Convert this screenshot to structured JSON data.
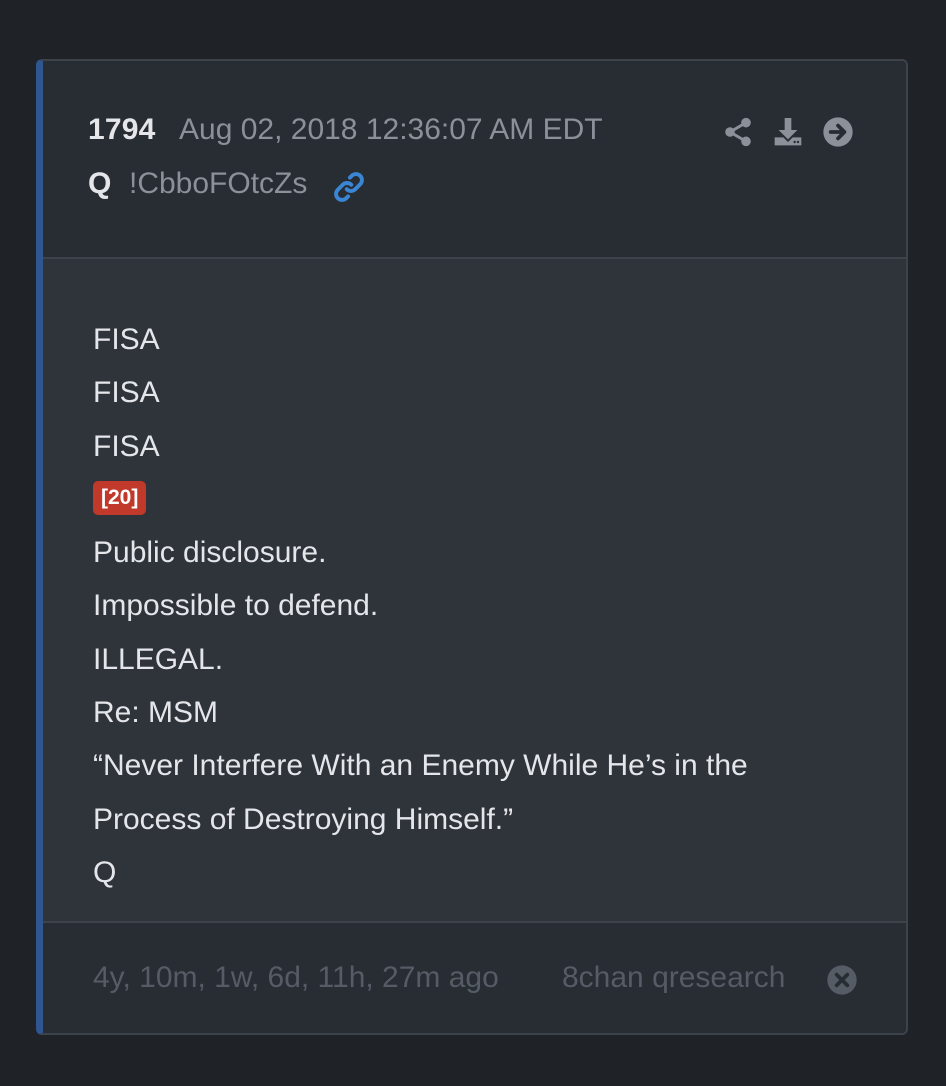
{
  "post": {
    "number": "1794",
    "date": "Aug 02, 2018 12:36:07 AM EDT",
    "author": "Q",
    "tripcode": "!CbboFOtcZs",
    "link_icon": "link-icon"
  },
  "actions": [
    {
      "icon": "share-icon"
    },
    {
      "icon": "download-icon"
    },
    {
      "icon": "arrow-right-circle-icon"
    }
  ],
  "body": {
    "line1": "FISA",
    "line2": "FISA",
    "line3": "FISA",
    "badge": "[20]",
    "line5": "Public disclosure.",
    "line6": "Impossible to defend.",
    "line7": "ILLEGAL.",
    "line8": "Re: MSM",
    "line9": "“Never Interfere With an Enemy While He’s in the",
    "line10": "Process of Destroying Himself.”",
    "line11": "Q"
  },
  "footer": {
    "elapsed": "4y, 10m, 1w, 6d, 11h, 27m ago",
    "source": "8chan qresearch",
    "close_icon": "close-circle-icon"
  },
  "colors": {
    "background": "#1f2226",
    "card": "#282c33",
    "body": "#2f343b",
    "accent_border": "#2f5690",
    "link": "#3a86d4",
    "badge": "#c0392b",
    "muted_text": "#8b9099",
    "footer_text": "#565c65"
  }
}
